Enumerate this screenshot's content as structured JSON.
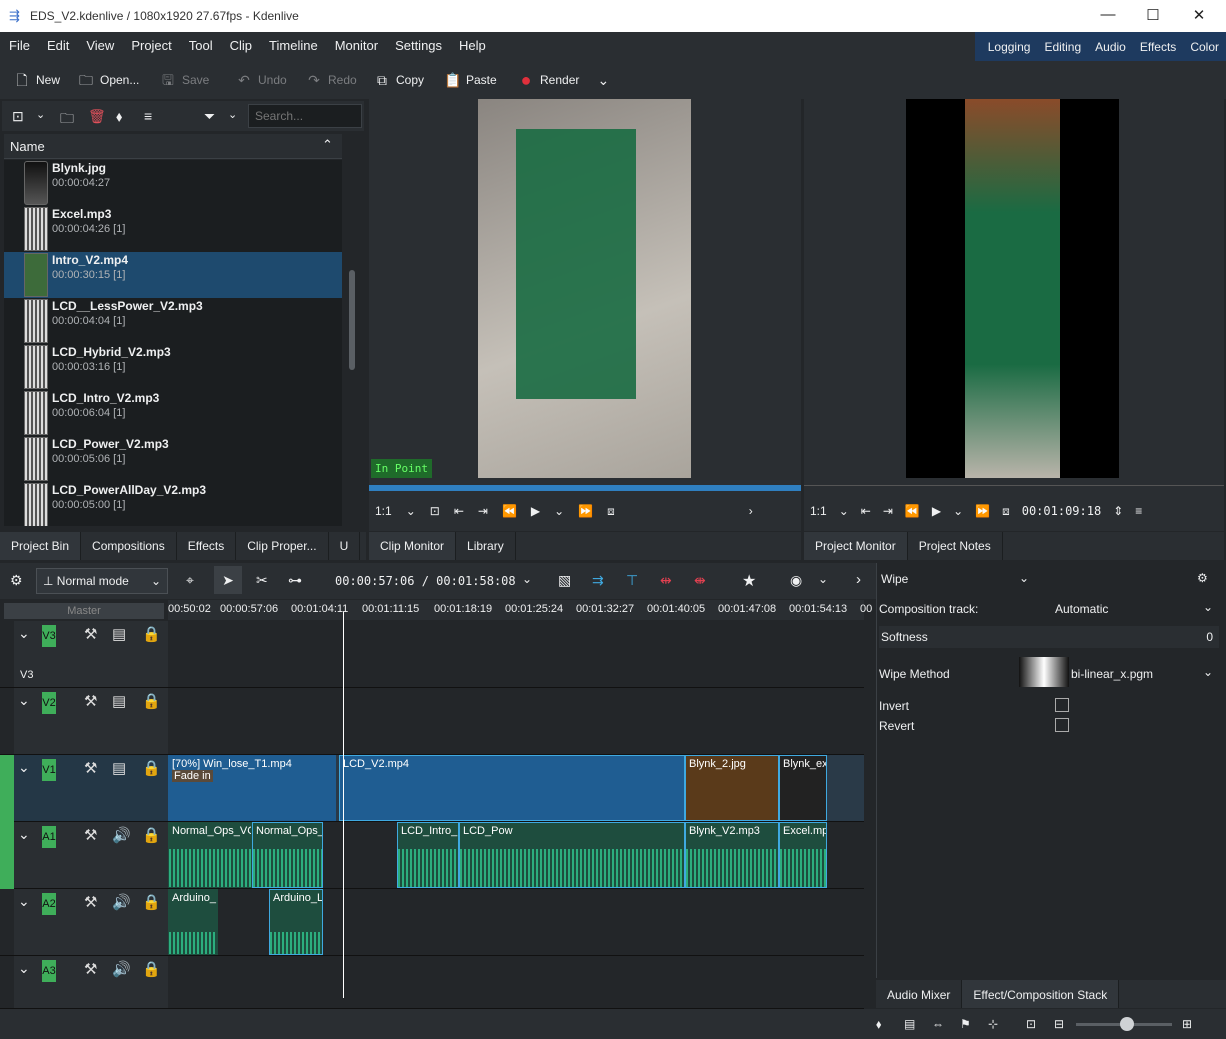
{
  "titlebar": {
    "title": "EDS_V2.kdenlive / 1080x1920 27.67fps - Kdenlive",
    "min": "—",
    "max": "☐",
    "close": "✕"
  },
  "menu": [
    "File",
    "Edit",
    "View",
    "Project",
    "Tool",
    "Clip",
    "Timeline",
    "Monitor",
    "Settings",
    "Help"
  ],
  "layouts": [
    "Logging",
    "Editing",
    "Audio",
    "Effects",
    "Color"
  ],
  "toolbar": {
    "new": "New",
    "open": "Open...",
    "save": "Save",
    "undo": "Undo",
    "redo": "Redo",
    "copy": "Copy",
    "paste": "Paste",
    "render": "Render"
  },
  "bin": {
    "search_placeholder": "Search...",
    "header": "Name",
    "items": [
      {
        "name": "Blynk.jpg",
        "dur": "00:00:04:27"
      },
      {
        "name": "Excel.mp3",
        "dur": "00:00:04:26 [1]"
      },
      {
        "name": "Intro_V2.mp4",
        "dur": "00:00:30:15 [1]"
      },
      {
        "name": "LCD__LessPower_V2.mp3",
        "dur": "00:00:04:04 [1]"
      },
      {
        "name": "LCD_Hybrid_V2.mp3",
        "dur": "00:00:03:16 [1]"
      },
      {
        "name": "LCD_Intro_V2.mp3",
        "dur": "00:00:06:04 [1]"
      },
      {
        "name": "LCD_Power_V2.mp3",
        "dur": "00:00:05:06 [1]"
      },
      {
        "name": "LCD_PowerAllDay_V2.mp3",
        "dur": "00:00:05:00 [1]"
      }
    ],
    "tabs": [
      "Project Bin",
      "Compositions",
      "Effects",
      "Clip Proper...",
      "U"
    ]
  },
  "clip_monitor": {
    "label": "In Point",
    "zoom": "1:1",
    "tabs": [
      "Clip Monitor",
      "Library"
    ]
  },
  "project_monitor": {
    "zoom": "1:1",
    "timecode": "00:01:09:18",
    "tabs": [
      "Project Monitor",
      "Project Notes"
    ]
  },
  "timeline": {
    "mode": "Normal mode",
    "position": "00:00:57:06 / 00:01:58:08",
    "master": "Master",
    "ruler": [
      "00:50:02",
      "00:00:57:06",
      "00:01:04:11",
      "00:01:11:15",
      "00:01:18:19",
      "00:01:25:24",
      "00:01:32:27",
      "00:01:40:05",
      "00:01:47:08",
      "00:01:54:13",
      "00"
    ],
    "tracks": [
      "V3",
      "V2",
      "V1",
      "A1",
      "A2",
      "A3"
    ],
    "v3_label": "V3",
    "clips": {
      "win_lose": "[70%] Win_lose_T1.mp4",
      "fade_in": "Fade in",
      "lcd_v2": "LCD_V2.mp4",
      "blynk2": "Blynk_2.jpg",
      "blynk_ex": "Blynk_ex",
      "normal1": "Normal_Ops_VC",
      "normal2": "Normal_Ops_",
      "lcd_intro": "LCD_Intro_",
      "lcd_pow": "LCD_Pow",
      "blynk_v2": "Blynk_V2.mp3",
      "excel": "Excel.mp",
      "arduino1": "Arduino_",
      "arduino2": "Arduino_L"
    }
  },
  "composition": {
    "name": "Wipe",
    "track_label": "Composition track:",
    "track_value": "Automatic",
    "softness_label": "Softness",
    "softness_value": "0",
    "wipe_label": "Wipe Method",
    "wipe_value": "bi-linear_x.pgm",
    "invert": "Invert",
    "revert": "Revert",
    "tabs": [
      "Audio Mixer",
      "Effect/Composition Stack"
    ]
  },
  "colors": {
    "accent": "#3fa9e0",
    "track_tag": "#3fae5a",
    "selected": "#1e4a6e"
  }
}
